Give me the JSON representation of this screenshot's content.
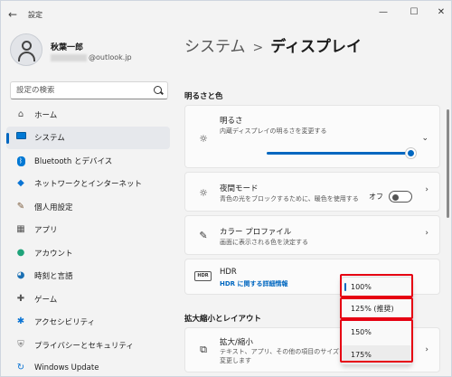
{
  "window": {
    "title": "設定",
    "minimize": "—",
    "maximize": "☐",
    "close": "✕"
  },
  "profile": {
    "name": "秋葉一郎",
    "email_suffix": "@outlook.jp"
  },
  "search": {
    "placeholder": "設定の検索"
  },
  "nav": {
    "items": [
      {
        "label": "ホーム",
        "icon": "home-icon"
      },
      {
        "label": "システム",
        "icon": "system-icon",
        "active": true
      },
      {
        "label": "Bluetooth とデバイス",
        "icon": "bluetooth-icon"
      },
      {
        "label": "ネットワークとインターネット",
        "icon": "network-icon"
      },
      {
        "label": "個人用設定",
        "icon": "personalization-icon"
      },
      {
        "label": "アプリ",
        "icon": "apps-icon"
      },
      {
        "label": "アカウント",
        "icon": "account-icon"
      },
      {
        "label": "時刻と言語",
        "icon": "time-language-icon"
      },
      {
        "label": "ゲーム",
        "icon": "gaming-icon"
      },
      {
        "label": "アクセシビリティ",
        "icon": "accessibility-icon"
      },
      {
        "label": "プライバシーとセキュリティ",
        "icon": "privacy-shield-icon"
      },
      {
        "label": "Windows Update",
        "icon": "windows-update-icon"
      }
    ]
  },
  "breadcrumb": {
    "parent": "システム",
    "separator": ">",
    "current": "ディスプレイ"
  },
  "sections": {
    "brightness_color": "明るさと色",
    "scale_layout": "拡大縮小とレイアウト"
  },
  "cards": {
    "brightness": {
      "title": "明るさ",
      "subtitle": "内蔵ディスプレイの明るさを変更する",
      "level": 0.97
    },
    "night_light": {
      "title": "夜間モード",
      "subtitle": "青色の光をブロックするために、暖色を使用する",
      "toggle_text": "オフ",
      "toggle_on": false
    },
    "color_profile": {
      "title": "カラー プロファイル",
      "subtitle": "画面に表示される色を決定する"
    },
    "hdr": {
      "title": "HDR",
      "link": "HDR に関する詳細情報",
      "icon_text": "HDR"
    },
    "scale": {
      "title": "拡大/縮小",
      "subtitle_line1": "テキスト、アプリ、その他の項目のサイズを",
      "subtitle_line2": "変更します"
    }
  },
  "scale_dropdown": {
    "options": [
      "100%",
      "125% (推奨)",
      "150%",
      "175%"
    ],
    "selected": "100%",
    "highlighted": "175%"
  },
  "colors": {
    "accent": "#0067c0",
    "annotation_red": "#e60012"
  }
}
